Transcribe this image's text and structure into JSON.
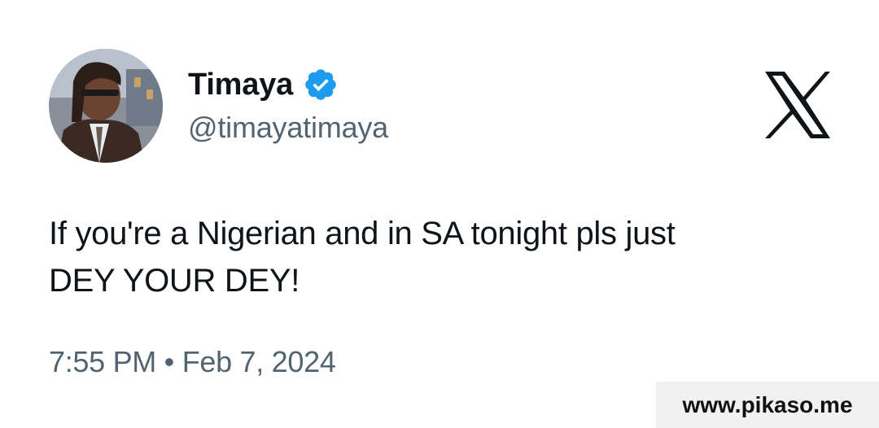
{
  "tweet": {
    "author": {
      "display_name": "Timaya",
      "handle": "@timayatimaya",
      "verified": true
    },
    "text_lines": [
      "If you're a Nigerian and in SA tonight pls just",
      "DEY YOUR DEY!"
    ],
    "time": "7:55 PM",
    "separator": "•",
    "date": "Feb 7, 2024"
  },
  "watermark": {
    "text": "www.pikaso.me"
  },
  "icons": {
    "platform_logo": "x-logo-icon",
    "verified_badge": "verified-badge-icon"
  },
  "colors": {
    "primary_text": "#0f1419",
    "secondary_text": "#536471",
    "verified_blue": "#1d9bf0",
    "background": "#ffffff"
  }
}
